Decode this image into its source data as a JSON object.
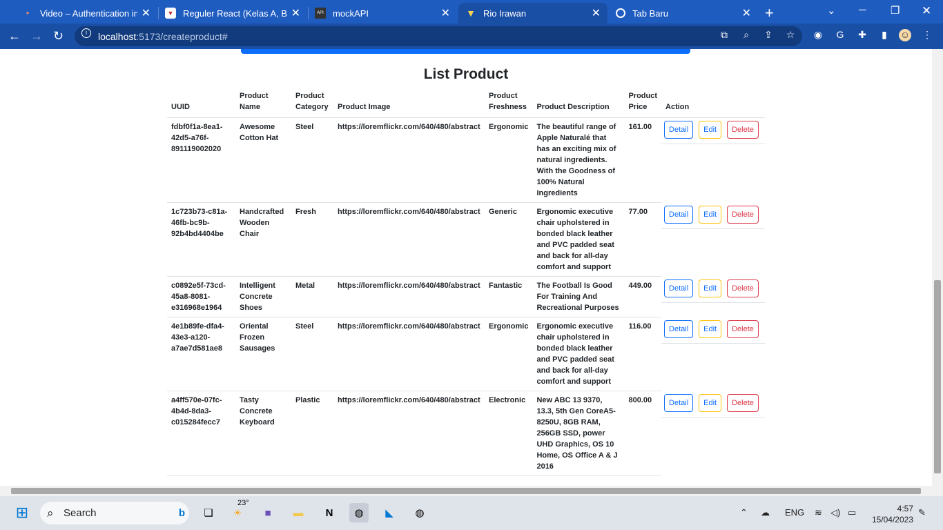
{
  "browser": {
    "tabs": [
      {
        "title": "Video – Authentication in React",
        "active": false
      },
      {
        "title": "Reguler React (Kelas A, B, dan C)",
        "active": false
      },
      {
        "title": "mockAPI",
        "active": false
      },
      {
        "title": "Rio Irawan",
        "active": true
      },
      {
        "title": "Tab Baru",
        "active": false
      }
    ],
    "url_host": "localhost",
    "url_path": ":5173/createproduct#"
  },
  "page": {
    "heading": "List Product",
    "columns": [
      "UUID",
      "Product Name",
      "Product Category",
      "Product Image",
      "Product Freshness",
      "Product Description",
      "Product Price",
      "Action"
    ],
    "rows": [
      {
        "uuid": "fdbf0f1a-8ea1-42d5-a76f-891119002020",
        "name": "Awesome Cotton Hat",
        "category": "Steel",
        "image": "https://loremflickr.com/640/480/abstract",
        "freshness": "Ergonomic",
        "description": "The beautiful range of Apple Naturalé that has an exciting mix of natural ingredients. With the Goodness of 100% Natural Ingredients",
        "price": "161.00"
      },
      {
        "uuid": "1c723b73-c81a-46fb-bc9b-92b4bd4404be",
        "name": "Handcrafted Wooden Chair",
        "category": "Fresh",
        "image": "https://loremflickr.com/640/480/abstract",
        "freshness": "Generic",
        "description": "Ergonomic executive chair upholstered in bonded black leather and PVC padded seat and back for all-day comfort and support",
        "price": "77.00"
      },
      {
        "uuid": "c0892e5f-73cd-45a8-8081-e316968e1964",
        "name": "Intelligent Concrete Shoes",
        "category": "Metal",
        "image": "https://loremflickr.com/640/480/abstract",
        "freshness": "Fantastic",
        "description": "The Football Is Good For Training And Recreational Purposes",
        "price": "449.00"
      },
      {
        "uuid": "4e1b89fe-dfa4-43e3-a120-a7ae7d581ae8",
        "name": "Oriental Frozen Sausages",
        "category": "Steel",
        "image": "https://loremflickr.com/640/480/abstract",
        "freshness": "Ergonomic",
        "description": "Ergonomic executive chair upholstered in bonded black leather and PVC padded seat and back for all-day comfort and support",
        "price": "116.00"
      },
      {
        "uuid": "a4ff570e-07fc-4b4d-8da3-c015284fecc7",
        "name": "Tasty Concrete Keyboard",
        "category": "Plastic",
        "image": "https://loremflickr.com/640/480/abstract",
        "freshness": "Electronic",
        "description": "New ABC 13 9370, 13.3, 5th Gen CoreA5-8250U, 8GB RAM, 256GB SSD, power UHD Graphics, OS 10 Home, OS Office A & J 2016",
        "price": "800.00"
      }
    ],
    "buttons": {
      "detail": "Detail",
      "edit": "Edit",
      "delete": "Delete"
    }
  },
  "taskbar": {
    "search_label": "Search",
    "weather": "23°",
    "language": "ENG",
    "time": "4:57",
    "date": "15/04/2023"
  }
}
